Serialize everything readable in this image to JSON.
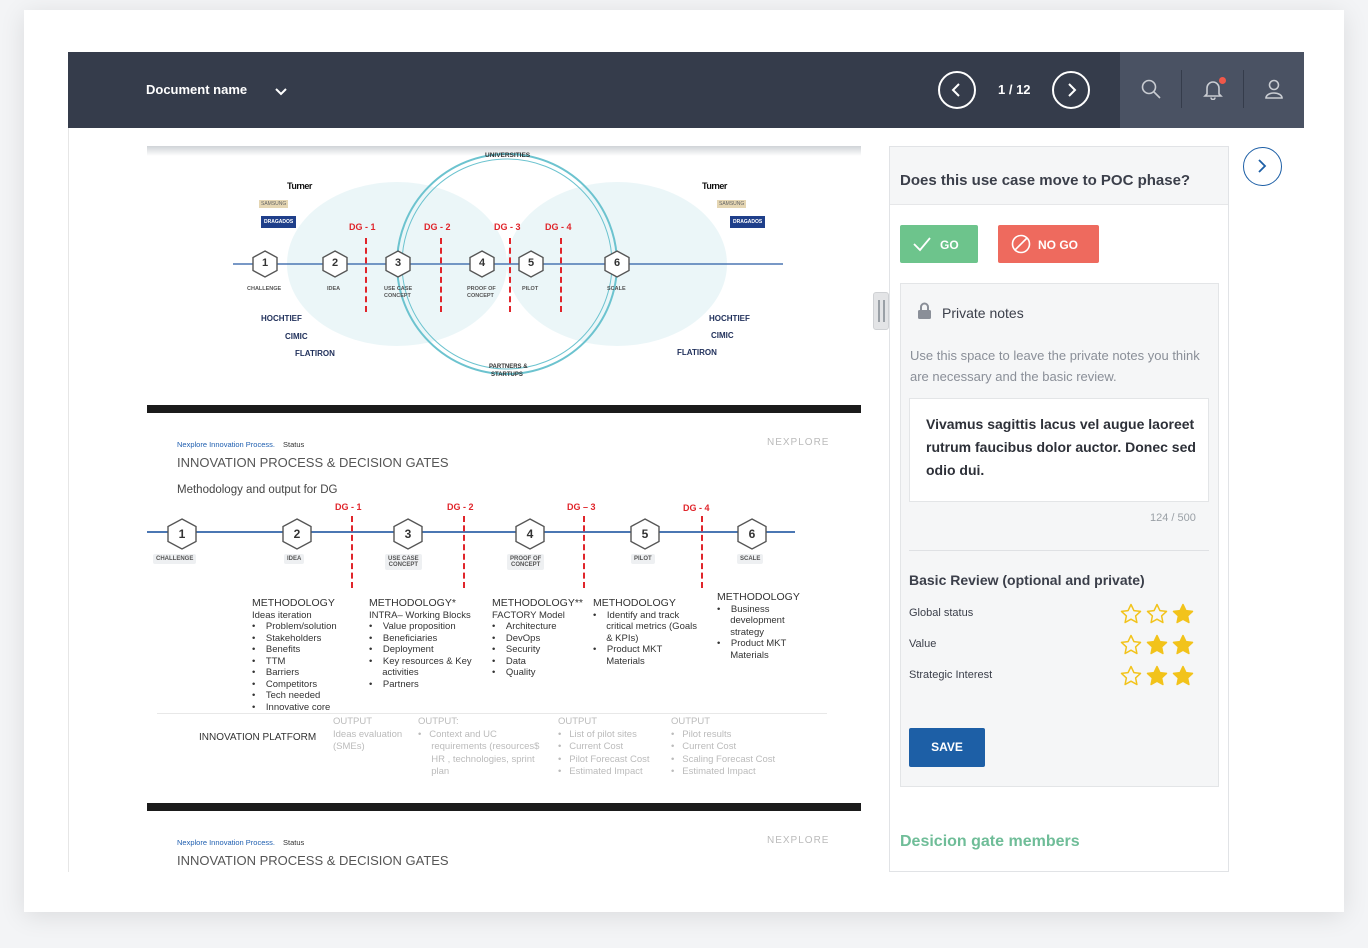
{
  "header": {
    "document_name": "Document name",
    "page_indicator": "1 / 12"
  },
  "slide1": {
    "universities": "UNIVERSITIES",
    "partners": "PARTNERS &",
    "startups": "STARTUPS",
    "logos": {
      "turner": "Turner",
      "small": "SAMSUNG",
      "dragados": "DRAGADOS",
      "hochtief": "HOCHTIEF",
      "cimic": "CIMIC",
      "flatiron": "FLATIRON"
    },
    "gates": [
      "DG - 1",
      "DG - 2",
      "DG - 3",
      "DG - 4"
    ],
    "steps": [
      {
        "num": "1",
        "label": "CHALLENGE",
        "label2": ""
      },
      {
        "num": "2",
        "label": "IDEA",
        "label2": ""
      },
      {
        "num": "3",
        "label": "USE CASE",
        "label2": "CONCEPT"
      },
      {
        "num": "4",
        "label": "PROOF OF",
        "label2": "CONCEPT"
      },
      {
        "num": "5",
        "label": "PILOT",
        "label2": ""
      },
      {
        "num": "6",
        "label": "SCALE",
        "label2": ""
      }
    ]
  },
  "slide2": {
    "brand_line_blue": "Nexplore Innovation Process.",
    "brand_line_rest": " Status",
    "title": "INNOVATION PROCESS & DECISION GATES",
    "subtitle": "Methodology and output for DG",
    "logo": "NEXPLORE",
    "gates": [
      "DG - 1",
      "DG - 2",
      "DG – 3",
      "DG - 4"
    ],
    "steps": [
      {
        "num": "1",
        "label": "CHALLENGE",
        "label2": ""
      },
      {
        "num": "2",
        "label": "IDEA",
        "label2": ""
      },
      {
        "num": "3",
        "label": "USE CASE",
        "label2": "CONCEPT"
      },
      {
        "num": "4",
        "label": "PROOF OF",
        "label2": "CONCEPT"
      },
      {
        "num": "5",
        "label": "PILOT",
        "label2": ""
      },
      {
        "num": "6",
        "label": "SCALE",
        "label2": ""
      }
    ],
    "methodology": [
      {
        "head": "METHODOLOGY",
        "sub": "Ideas iteration",
        "items": [
          "Problem/solution",
          "Stakeholders",
          "Benefits",
          "TTM",
          "Barriers",
          "Competitors",
          "Tech needed",
          "Innovative core"
        ]
      },
      {
        "head": "METHODOLOGY*",
        "sub": "INTRA– Working Blocks",
        "items": [
          "Value proposition",
          "Beneficiaries",
          "Deployment",
          "Key resources & Key",
          "activities",
          "Partners"
        ]
      },
      {
        "head": "METHODOLOGY**",
        "sub": "FACTORY Model",
        "items": [
          "Architecture",
          "DevOps",
          "Security",
          "Data",
          "Quality"
        ]
      },
      {
        "head": "METHODOLOGY",
        "sub": "",
        "items": [
          "Identify and track",
          "critical metrics (Goals",
          "& KPIs)",
          "Product MKT",
          "Materials"
        ]
      },
      {
        "head": "METHODOLOGY",
        "sub": "",
        "items": [
          "Business",
          "development",
          "strategy",
          "Product MKT",
          "Materials"
        ]
      }
    ],
    "platform": "INNOVATION PLATFORM",
    "outputs": [
      {
        "head": "OUTPUT",
        "lines": [
          "Ideas evaluation",
          "(SMEs)"
        ]
      },
      {
        "head": "OUTPUT:",
        "lines": [
          "Context and UC",
          "requirements (resources$",
          "HR , technologies, sprint",
          "plan"
        ]
      },
      {
        "head": "OUTPUT",
        "lines": [
          "List of pilot sites",
          "Current Cost",
          "Pilot Forecast Cost",
          "Estimated Impact"
        ]
      },
      {
        "head": "OUTPUT",
        "lines": [
          "Pilot results",
          "Current Cost",
          "Scaling Forecast Cost",
          "Estimated Impact"
        ]
      }
    ]
  },
  "slide3": {
    "brand_line_blue": "Nexplore Innovation Process.",
    "brand_line_rest": " Status",
    "title": "INNOVATION PROCESS & DECISION GATES",
    "logo": "NEXPLORE"
  },
  "panel": {
    "question": "Does this use case move to POC phase?",
    "go_label": "GO",
    "nogo_label": "NO GO",
    "notes_title": "Private notes",
    "notes_help": "Use this space to leave the private notes you think are necessary and the basic review.",
    "notes_value": "Vivamus sagittis lacus vel augue laoreet rutrum faucibus dolor auctor. Donec sed odio dui.",
    "counter": "124 / 500",
    "review_title": "Basic Review (optional and private)",
    "reviews": [
      {
        "label": "Global status",
        "rating": 1
      },
      {
        "label": "Value",
        "rating": 2
      },
      {
        "label": "Strategic Interest",
        "rating": 2
      }
    ],
    "save_label": "SAVE",
    "members_title": "Desicion gate members"
  },
  "colors": {
    "topbar": "#353c4b",
    "go": "#6dc48c",
    "nogo": "#ee6a5e",
    "save": "#1d5fa6",
    "star": "#f2c31b",
    "members": "#6fbd98",
    "gate_red": "#e0252b"
  },
  "icons": [
    "chevron-down-icon",
    "chevron-left-icon",
    "chevron-right-icon",
    "search-icon",
    "bell-icon",
    "user-icon",
    "check-icon",
    "ban-icon",
    "lock-icon",
    "star-icon",
    "drag-handle-icon"
  ]
}
